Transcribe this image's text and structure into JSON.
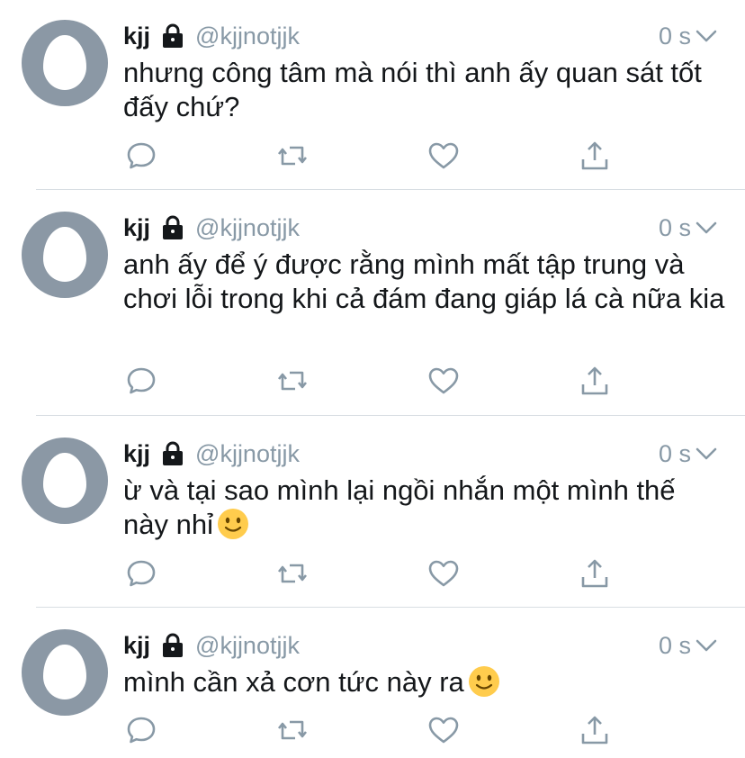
{
  "colors": {
    "avatar_bg": "#8b98a5",
    "handle": "#8899a6",
    "text": "#14171a",
    "icon": "#8899a6",
    "divider": "#d8dee3"
  },
  "tweets": [
    {
      "name": "kjj",
      "handle": "@kjjnotjjk",
      "time": "0 s",
      "text": "nhưng công tâm mà nói thì anh ấy quan sát tốt đấy chứ?",
      "emoji": "",
      "icons": [
        "egg-avatar",
        "lock-icon",
        "chevron-down-icon",
        "reply-icon",
        "retweet-icon",
        "heart-icon",
        "share-icon"
      ]
    },
    {
      "name": "kjj",
      "handle": "@kjjnotjjk",
      "time": "0 s",
      "text": "anh ấy để ý được rằng mình mất tập trung và chơi lỗi trong khi cả đám đang giáp lá cà nữa kia",
      "emoji": "",
      "icons": [
        "egg-avatar",
        "lock-icon",
        "chevron-down-icon",
        "reply-icon",
        "retweet-icon",
        "heart-icon",
        "share-icon"
      ]
    },
    {
      "name": "kjj",
      "handle": "@kjjnotjjk",
      "time": "0 s",
      "text": "ừ và tại sao mình lại ngồi nhắn một mình thế này nhỉ",
      "emoji": "slightly-smiling-face",
      "icons": [
        "egg-avatar",
        "lock-icon",
        "chevron-down-icon",
        "reply-icon",
        "retweet-icon",
        "heart-icon",
        "share-icon"
      ]
    },
    {
      "name": "kjj",
      "handle": "@kjjnotjjk",
      "time": "0 s",
      "text": "mình cần xả cơn tức này ra",
      "emoji": "slightly-smiling-face",
      "icons": [
        "egg-avatar",
        "lock-icon",
        "chevron-down-icon",
        "reply-icon",
        "retweet-icon",
        "heart-icon",
        "share-icon"
      ]
    }
  ]
}
